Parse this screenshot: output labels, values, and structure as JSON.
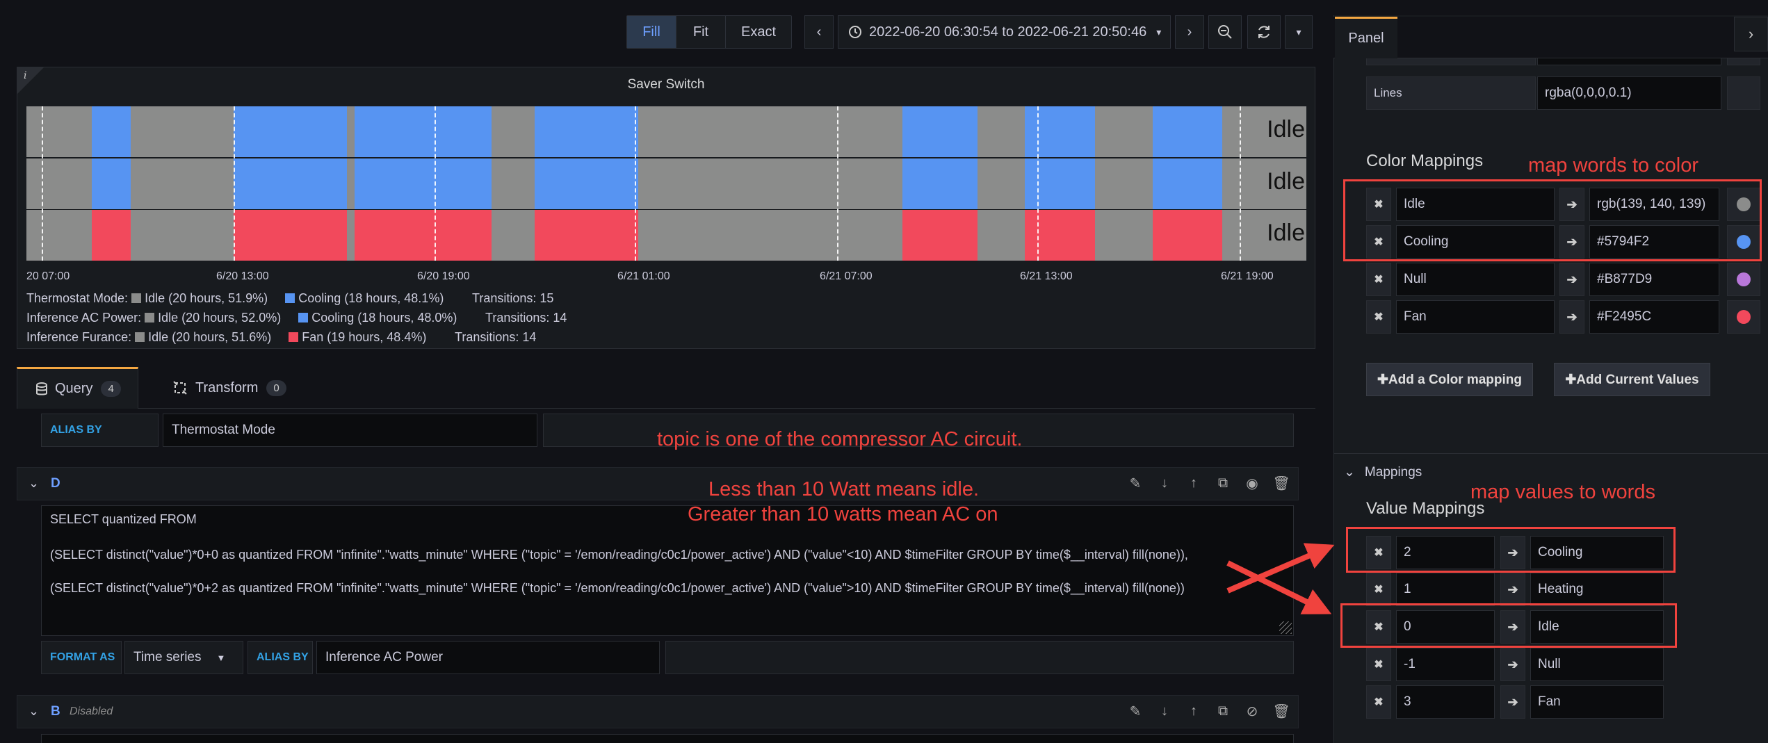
{
  "toolbar": {
    "zoom_modes": [
      "Fill",
      "Fit",
      "Exact"
    ],
    "time_range": "2022-06-20 06:30:54 to 2022-06-21 20:50:46"
  },
  "panel": {
    "title": "Saver Switch",
    "info_glyph": "i",
    "row_labels": [
      "Idle",
      "Idle",
      "Idle"
    ],
    "x_ticks": [
      "20 07:00",
      "6/20 13:00",
      "6/20 19:00",
      "6/21 01:00",
      "6/21 07:00",
      "6/21 13:00",
      "6/21 19:00"
    ],
    "legend": [
      {
        "name": "Thermostat Mode:",
        "a_label": "Idle (20 hours, 51.9%)",
        "b_label": "Cooling (18 hours, 48.1%)",
        "transitions": "Transitions: 15",
        "b_color": "#5794F2"
      },
      {
        "name": "Inference AC Power:",
        "a_label": "Idle (20 hours, 52.0%)",
        "b_label": "Cooling (18 hours, 48.0%)",
        "transitions": "Transitions: 14",
        "b_color": "#5794F2"
      },
      {
        "name": "Inference Furance:",
        "a_label": "Idle (20 hours, 51.6%)",
        "b_label": "Fan (19 hours, 48.4%)",
        "transitions": "Transitions: 14",
        "b_color": "#F2495C"
      }
    ],
    "colors": {
      "idle": "#8b8c8b",
      "cooling": "#5794F2",
      "fan": "#F2495C"
    }
  },
  "query_tabs": [
    {
      "label": "Query",
      "count": "4"
    },
    {
      "label": "Transform",
      "count": "0"
    }
  ],
  "query_editor": {
    "alias_label": "ALIAS BY",
    "alias_value_top": "Thermostat Mode",
    "query_d_letter": "D",
    "sql_lines": [
      "SELECT quantized FROM",
      "(SELECT distinct(\"value\")*0+0 as quantized FROM \"infinite\".\"watts_minute\" WHERE (\"topic\" = '/emon/reading/c0c1/power_active') AND (\"value\"<10) AND $timeFilter GROUP BY time($__interval) fill(none)),",
      "(SELECT distinct(\"value\")*0+2 as quantized FROM \"infinite\".\"watts_minute\" WHERE (\"topic\" = '/emon/reading/c0c1/power_active') AND (\"value\">10) AND $timeFilter GROUP BY time($__interval) fill(none))"
    ],
    "format_label": "FORMAT AS",
    "format_value": "Time series",
    "alias_value_d": "Inference AC Power",
    "query_b_letter": "B",
    "query_b_status": "Disabled"
  },
  "right_pane": {
    "tab": "Panel",
    "lines_label": "Lines",
    "lines_value": "rgba(0,0,0,0.1)",
    "color_mappings_title": "Color Mappings",
    "color_mappings": [
      {
        "word": "Idle",
        "color_text": "rgb(139, 140, 139)",
        "dot": "#8b8c8b"
      },
      {
        "word": "Cooling",
        "color_text": "#5794F2",
        "dot": "#5794F2"
      },
      {
        "word": "Null",
        "color_text": "#B877D9",
        "dot": "#B877D9"
      },
      {
        "word": "Fan",
        "color_text": "#F2495C",
        "dot": "#F2495C"
      }
    ],
    "add_color_mapping": "✚Add a Color mapping",
    "add_current_values": "✚Add Current Values",
    "mappings_section": "Mappings",
    "value_mappings_title": "Value Mappings",
    "value_mappings": [
      {
        "value": "2",
        "text": "Cooling"
      },
      {
        "value": "1",
        "text": "Heating"
      },
      {
        "value": "0",
        "text": "Idle"
      },
      {
        "value": "-1",
        "text": "Null"
      },
      {
        "value": "3",
        "text": "Fan"
      }
    ]
  },
  "annotations": {
    "map_words": "map words to color",
    "map_values": "map values to words",
    "topic_note": "topic is one of the compressor AC circuit.",
    "watt_note_1": "Less than 10 Watt means idle.",
    "watt_note_2": "Greater than 10 watts mean AC on"
  }
}
